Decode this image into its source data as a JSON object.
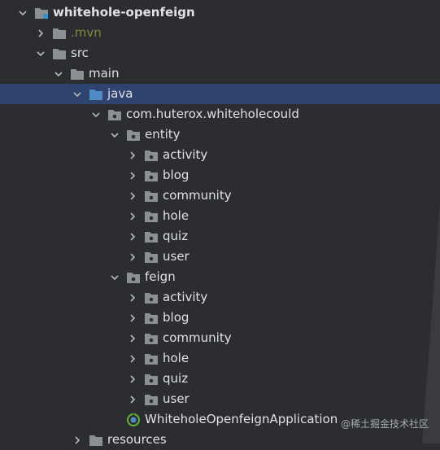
{
  "tree": {
    "rows": [
      {
        "label": "whitehole-openfeign",
        "kind": "module"
      },
      {
        "label": ".mvn",
        "kind": "folder"
      },
      {
        "label": "src",
        "kind": "folder"
      },
      {
        "label": "main",
        "kind": "folder"
      },
      {
        "label": "java",
        "kind": "source-root"
      },
      {
        "label": "com.huterox.whiteholecould",
        "kind": "package"
      },
      {
        "label": "entity",
        "kind": "package"
      },
      {
        "label": "activity",
        "kind": "package"
      },
      {
        "label": "blog",
        "kind": "package"
      },
      {
        "label": "community",
        "kind": "package"
      },
      {
        "label": "hole",
        "kind": "package"
      },
      {
        "label": "quiz",
        "kind": "package"
      },
      {
        "label": "user",
        "kind": "package"
      },
      {
        "label": "feign",
        "kind": "package"
      },
      {
        "label": "activity",
        "kind": "package"
      },
      {
        "label": "blog",
        "kind": "package"
      },
      {
        "label": "community",
        "kind": "package"
      },
      {
        "label": "hole",
        "kind": "package"
      },
      {
        "label": "quiz",
        "kind": "package"
      },
      {
        "label": "user",
        "kind": "package"
      },
      {
        "label": "WhiteholeOpenfeignApplication",
        "kind": "spring-class"
      },
      {
        "label": "resources",
        "kind": "folder"
      }
    ]
  },
  "watermark": "@稀土掘金技术社区",
  "colors": {
    "background": "#2b2d30",
    "selection": "#2e436e",
    "folder": "#8c8f94",
    "source_root": "#4f8bc9",
    "mvn_text": "#7d8b3a",
    "spring": "#5fb832",
    "text": "#dfe1e5"
  }
}
